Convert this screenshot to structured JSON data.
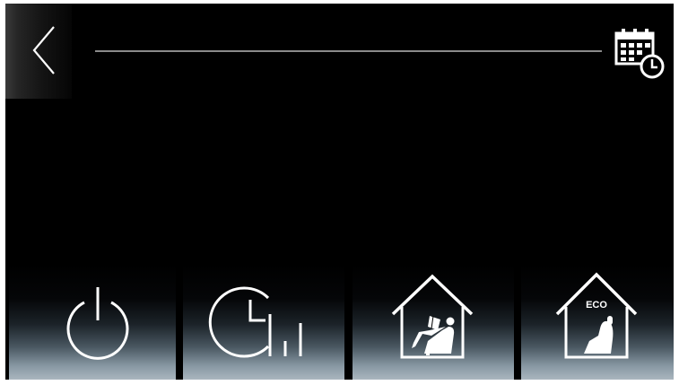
{
  "top_bar": {
    "back_icon": "chevron-left-icon",
    "schedule_icon": "calendar-clock-icon"
  },
  "mode_buttons": [
    {
      "id": "power",
      "icon": "power-icon"
    },
    {
      "id": "timer",
      "icon": "timer-bars-icon"
    },
    {
      "id": "home-comfort",
      "icon": "house-person-relaxing-icon"
    },
    {
      "id": "eco",
      "icon": "house-eco-icon",
      "badge": "ECO"
    }
  ],
  "colors": {
    "background": "#000000",
    "icon": "#ffffff",
    "button_gradient_bottom": "#aab6bf"
  }
}
